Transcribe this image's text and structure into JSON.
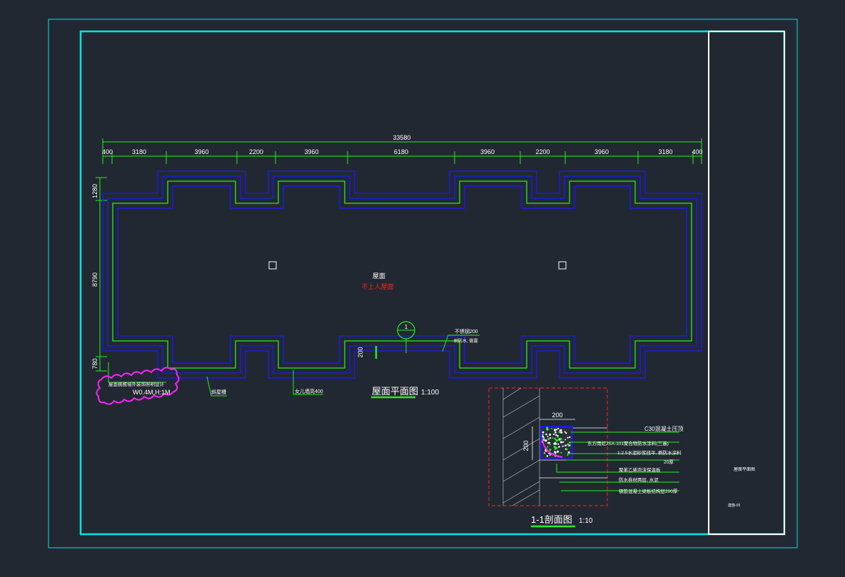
{
  "colors": {
    "background": "#222831",
    "frame": "#00e5e5",
    "wall_blue": "#1a1aff",
    "wall_green": "#22ee22",
    "section_red": "#ff2020",
    "cloud_magenta": "#ff22ff",
    "text": "#ffffff",
    "roof_note_red": "#ff2020"
  },
  "plan": {
    "overall_dim": "33580",
    "top_dims": [
      "400",
      "3180",
      "3960",
      "2200",
      "3960",
      "6180",
      "3960",
      "2200",
      "3960",
      "3180",
      "400"
    ],
    "left_dims": [
      "1280",
      "8790",
      "780"
    ],
    "roof_label": "屋面",
    "roof_note": "不上人屋面",
    "section_marker": "1",
    "small_dim_200": "200",
    "callouts": {
      "right_line1": "不锈钢200",
      "right_line2": "刷防水, 做漏",
      "bottom_a": "斜屋槽",
      "bottom_b": "女儿墙高400"
    },
    "cloud_line1": "屋面挑檐墙外装饰照明设计",
    "cloud_line2": "W0.4M,H:1M",
    "title": "屋面平面图",
    "scale": "1:100"
  },
  "section": {
    "dim_top": "200",
    "dim_left": "200",
    "labels": [
      "C30混凝土压顶",
      "东方雨虹JSA-101聚合物防水涂料(三遍)",
      "1:2.5水泥砂浆找平, 刷防水涂料",
      "20厚",
      "聚苯乙烯泡沫保温板",
      "防水卷材两层, 水泥",
      "钢筋混凝土梁板结构层200厚"
    ],
    "title": "1-1剖面图",
    "scale": "1:10"
  },
  "title_block": {
    "drawing_name": "屋面平面图",
    "drawing_no": "建施-05"
  }
}
